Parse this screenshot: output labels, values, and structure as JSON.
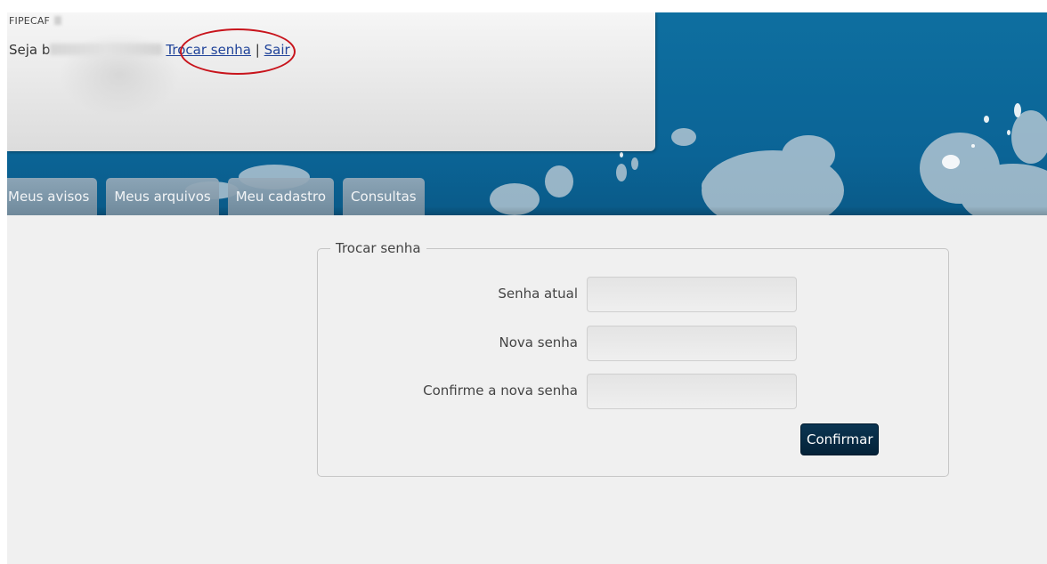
{
  "header": {
    "org_name": "FIPECAF",
    "welcome_prefix": "Seja b",
    "change_password_link": "Trocar senha",
    "separator": "|",
    "logout_link": "Sair"
  },
  "tabs": [
    {
      "label": "Meus avisos"
    },
    {
      "label": "Meus arquivos"
    },
    {
      "label": "Meu cadastro"
    },
    {
      "label": "Consultas"
    }
  ],
  "form": {
    "legend": "Trocar senha",
    "fields": [
      {
        "label": "Senha atual",
        "value": ""
      },
      {
        "label": "Nova senha",
        "value": ""
      },
      {
        "label": "Confirme a nova senha",
        "value": ""
      }
    ],
    "submit_label": "Confirmar"
  },
  "colors": {
    "banner_blue": "#0e6fa0",
    "link": "#21449a",
    "highlight_ring": "#c8141c",
    "button": "#042238"
  }
}
